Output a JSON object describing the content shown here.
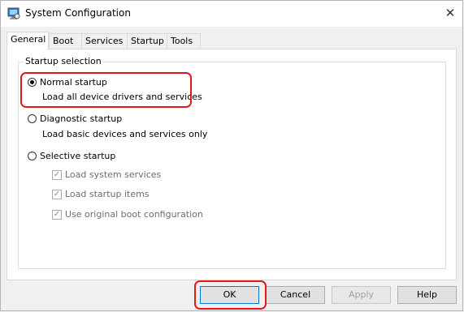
{
  "window": {
    "title": "System Configuration",
    "close_glyph": "✕"
  },
  "tabs": [
    {
      "label": "General",
      "active": true
    },
    {
      "label": "Boot"
    },
    {
      "label": "Services"
    },
    {
      "label": "Startup"
    },
    {
      "label": "Tools"
    }
  ],
  "startup_selection": {
    "legend": "Startup selection",
    "normal": {
      "label": "Normal startup",
      "description": "Load all device drivers and services",
      "selected": true
    },
    "diagnostic": {
      "label": "Diagnostic startup",
      "description": "Load basic devices and services only",
      "selected": false
    },
    "selective": {
      "label": "Selective startup",
      "selected": false,
      "options": [
        {
          "label": "Load system services",
          "checked": true,
          "enabled": false
        },
        {
          "label": "Load startup items",
          "checked": true,
          "enabled": false
        },
        {
          "label": "Use original boot configuration",
          "checked": true,
          "enabled": false
        }
      ]
    }
  },
  "buttons": {
    "ok": "OK",
    "cancel": "Cancel",
    "apply": "Apply",
    "help": "Help"
  },
  "colors": {
    "highlight": "#e0191a",
    "accent": "#0078d7"
  }
}
